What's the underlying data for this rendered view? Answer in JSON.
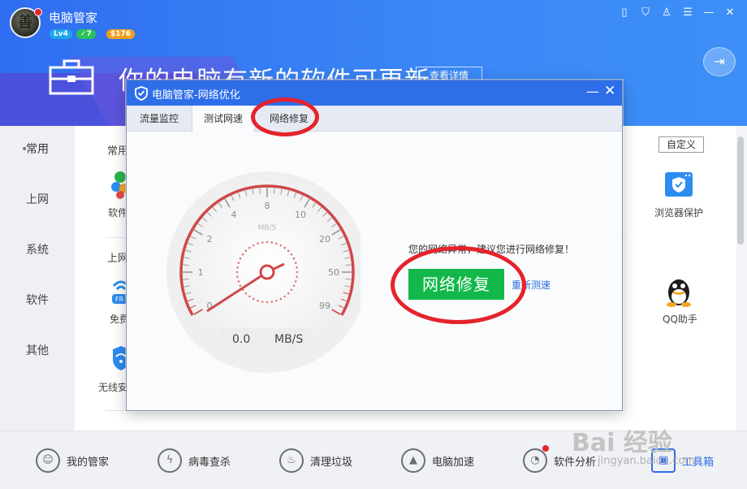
{
  "app": {
    "title": "电脑管家",
    "avatar_char": "善",
    "badges": {
      "level": "Lv4",
      "green": "✓7",
      "gold": "$176"
    }
  },
  "header": {
    "headline": "你的电脑有新的软件可更新",
    "details_button": "查看详情"
  },
  "sidebar": {
    "items": [
      {
        "label": "常用"
      },
      {
        "label": "上网"
      },
      {
        "label": "系统"
      },
      {
        "label": "软件"
      },
      {
        "label": "其他"
      }
    ]
  },
  "content": {
    "section_common": "常用",
    "section_internet": "上网",
    "custom_button": "自定义",
    "tools": [
      {
        "label": "软件"
      },
      {
        "label": "免费"
      },
      {
        "label": "无线安"
      },
      {
        "label": "浏览器保护"
      },
      {
        "label": "QQ助手"
      }
    ]
  },
  "dialog": {
    "title": "电脑管家-网络优化",
    "tabs": [
      {
        "label": "流量监控"
      },
      {
        "label": "测试网速"
      },
      {
        "label": "网络修复"
      }
    ],
    "status_message": "您的网络异常，建议您进行网络修复！",
    "repair_button": "网络修复",
    "retest_link": "重新测速",
    "speed_value": "0.0",
    "speed_unit": "MB/S",
    "gauge_unit": "MB/S",
    "gauge_ticks": [
      "0",
      "1",
      "2",
      "4",
      "8",
      "10",
      "20",
      "50",
      "99"
    ]
  },
  "dock": {
    "items": [
      {
        "label": "我的管家"
      },
      {
        "label": "病毒查杀"
      },
      {
        "label": "清理垃圾"
      },
      {
        "label": "电脑加速"
      },
      {
        "label": "软件分析"
      },
      {
        "label": "工具箱"
      }
    ]
  },
  "watermark": {
    "text": "Bai 经验",
    "url": "jingyan.baidu.com"
  },
  "colors": {
    "header_blue": "#3a86f5",
    "title_bar_blue": "#2e6ee9",
    "repair_green": "#12b94a",
    "annotation_red": "#e5232c",
    "gauge_red": "#d04848"
  }
}
